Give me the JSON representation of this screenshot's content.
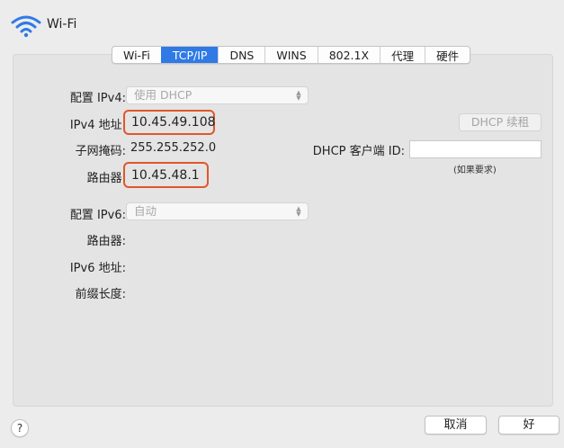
{
  "header": {
    "title": "Wi-Fi",
    "icon": "wifi-icon"
  },
  "tabs": [
    {
      "label": "Wi-Fi",
      "active": false
    },
    {
      "label": "TCP/IP",
      "active": true
    },
    {
      "label": "DNS",
      "active": false
    },
    {
      "label": "WINS",
      "active": false
    },
    {
      "label": "802.1X",
      "active": false
    },
    {
      "label": "代理",
      "active": false
    },
    {
      "label": "硬件",
      "active": false
    }
  ],
  "ipv4": {
    "configure_label": "配置 IPv4:",
    "configure_value": "使用 DHCP",
    "address_label": "IPv4 地址:",
    "address_value": "10.45.49.108",
    "subnet_label": "子网掩码:",
    "subnet_value": "255.255.252.0",
    "router_label": "路由器:",
    "router_value": "10.45.48.1",
    "renew_button": "DHCP 续租",
    "client_id_label": "DHCP 客户端 ID:",
    "client_id_value": "",
    "client_id_hint": "(如果要求)"
  },
  "ipv6": {
    "configure_label": "配置 IPv6:",
    "configure_value": "自动",
    "router_label": "路由器:",
    "address_label": "IPv6 地址:",
    "prefix_label": "前缀长度:"
  },
  "footer": {
    "help_label": "?",
    "cancel_label": "取消",
    "ok_label": "好"
  },
  "colors": {
    "accent": "#2f7ae5",
    "highlight": "#e0562a"
  }
}
